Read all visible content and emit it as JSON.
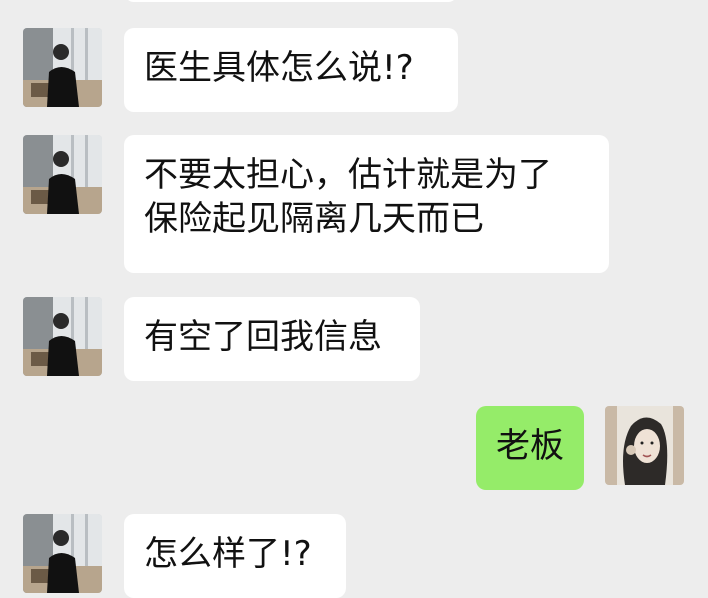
{
  "conversation": {
    "messages": [
      {
        "side": "left",
        "lines": [
          ""
        ]
      },
      {
        "side": "left",
        "lines": [
          "医生具体怎么说!?"
        ]
      },
      {
        "side": "left",
        "lines": [
          "不要太担心，估计就是为了",
          "保险起见隔离几天而已"
        ]
      },
      {
        "side": "left",
        "lines": [
          "有空了回我信息"
        ]
      },
      {
        "side": "right",
        "lines": [
          "老板"
        ]
      },
      {
        "side": "left",
        "lines": [
          "怎么样了!?"
        ]
      }
    ]
  },
  "colors": {
    "background": "#ededed",
    "incoming_bubble": "#ffffff",
    "outgoing_bubble": "#95ec69",
    "text": "#111111"
  },
  "icons": {
    "contact_avatar": "man-in-office-photo",
    "self_avatar": "woman-sketch-photo"
  }
}
